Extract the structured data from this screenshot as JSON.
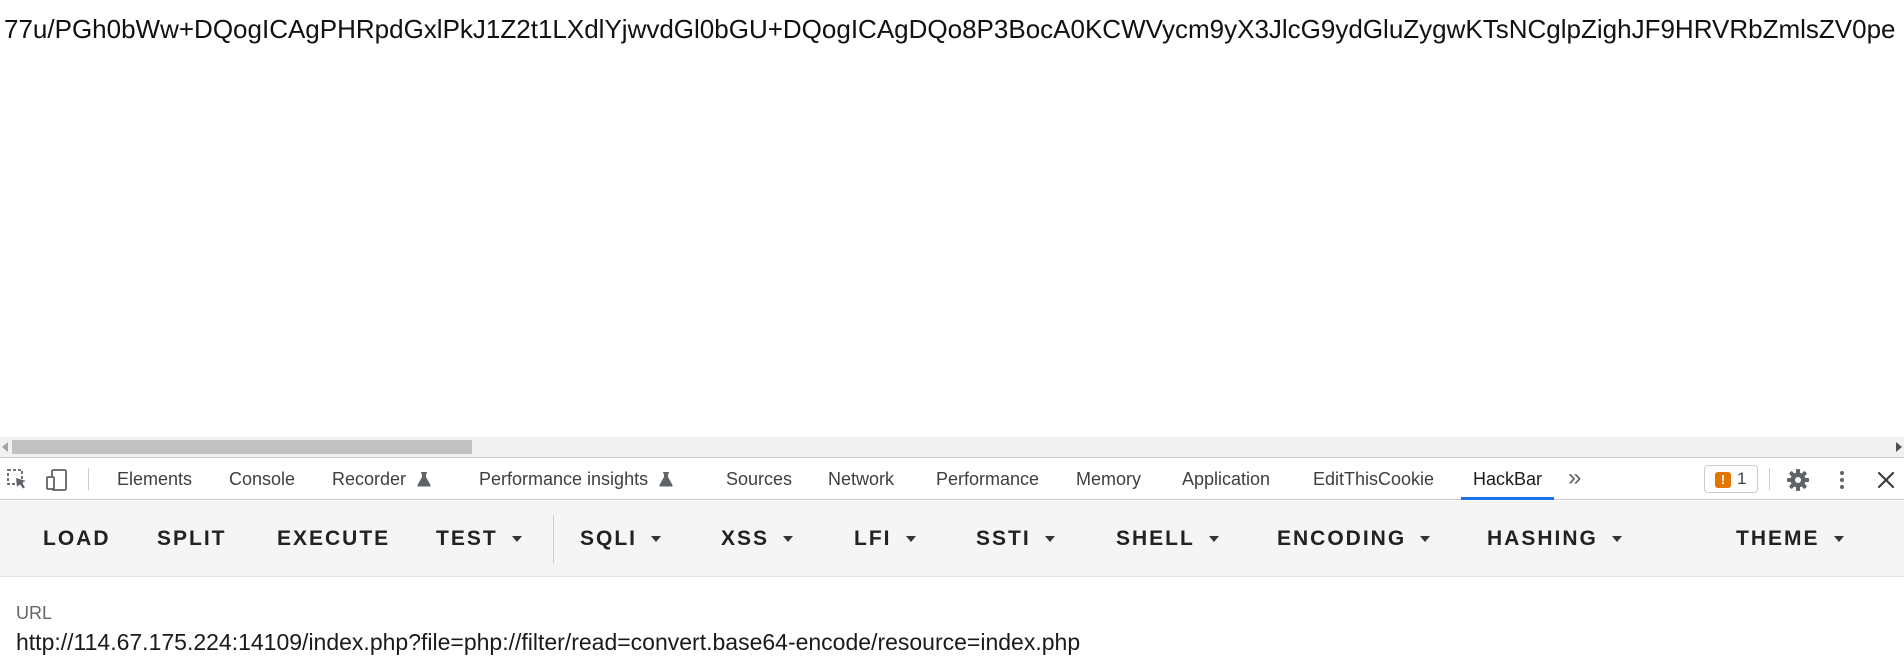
{
  "page": {
    "body_text": "77u/PGh0bWw+DQogICAgPHRpdGxlPkJ1Z2t1LXdlYjwvdGl0bGU+DQogICAgDQo8P3BocA0KCWVycm9yX3JlcG9ydGluZygwKTsNCglpZighJF9HRVRbZmlsZV0pe"
  },
  "devtools": {
    "tabs": [
      {
        "label": "Elements"
      },
      {
        "label": "Console"
      },
      {
        "label": "Recorder"
      },
      {
        "label": "Performance insights"
      },
      {
        "label": "Sources"
      },
      {
        "label": "Network"
      },
      {
        "label": "Performance"
      },
      {
        "label": "Memory"
      },
      {
        "label": "Application"
      },
      {
        "label": "EditThisCookie"
      },
      {
        "label": "HackBar"
      }
    ],
    "active_tab": "HackBar",
    "more_tabs_glyph": "»",
    "issues_count": "1",
    "issues_icon_glyph": "!"
  },
  "hackbar": {
    "buttons": [
      {
        "label": "LOAD"
      },
      {
        "label": "SPLIT"
      },
      {
        "label": "EXECUTE"
      },
      {
        "label": "TEST"
      },
      {
        "label": "SQLI"
      },
      {
        "label": "XSS"
      },
      {
        "label": "LFI"
      },
      {
        "label": "SSTI"
      },
      {
        "label": "SHELL"
      },
      {
        "label": "ENCODING"
      },
      {
        "label": "HASHING"
      },
      {
        "label": "THEME"
      }
    ],
    "url_label": "URL",
    "url_value": "http://114.67.175.224:14109/index.php?file=php://filter/read=convert.base64-encode/resource=index.php"
  },
  "colors": {
    "active_tab_underline": "#1a73e8",
    "issue_warning": "#e37400",
    "toolbar_bg": "#f5f5f5"
  }
}
